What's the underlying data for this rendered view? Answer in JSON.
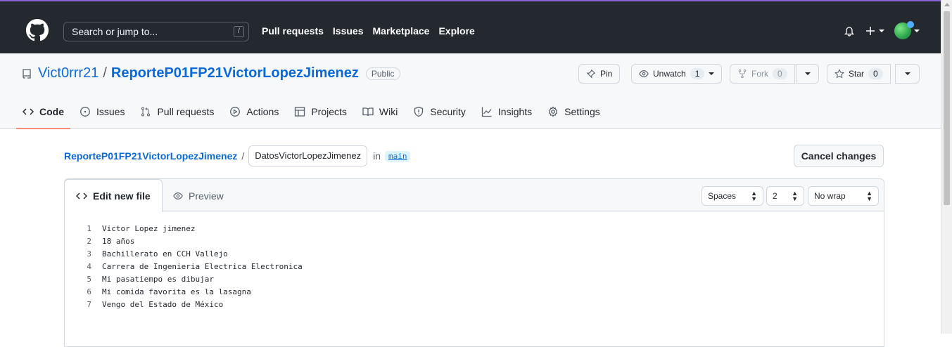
{
  "header": {
    "search_placeholder": "Search or jump to...",
    "slash_key": "/",
    "nav": [
      "Pull requests",
      "Issues",
      "Marketplace",
      "Explore"
    ]
  },
  "repo": {
    "owner": "Vict0rrr21",
    "separator": "/",
    "name": "ReporteP01FP21VictorLopezJimenez",
    "visibility": "Public",
    "pin_label": "Pin",
    "unwatch_label": "Unwatch",
    "unwatch_count": "1",
    "fork_label": "Fork",
    "fork_count": "0",
    "star_label": "Star",
    "star_count": "0"
  },
  "tabs": [
    {
      "label": "Code",
      "icon": "code-icon",
      "active": true
    },
    {
      "label": "Issues",
      "icon": "issue-icon"
    },
    {
      "label": "Pull requests",
      "icon": "pull-request-icon"
    },
    {
      "label": "Actions",
      "icon": "play-icon"
    },
    {
      "label": "Projects",
      "icon": "table-icon"
    },
    {
      "label": "Wiki",
      "icon": "book-icon"
    },
    {
      "label": "Security",
      "icon": "shield-icon"
    },
    {
      "label": "Insights",
      "icon": "graph-icon"
    },
    {
      "label": "Settings",
      "icon": "gear-icon"
    }
  ],
  "editor_path": {
    "root": "ReporteP01FP21VictorLopezJimenez",
    "slash": "/",
    "filename": "DatosVictorLopezJimenez",
    "in_label": "in",
    "branch": "main",
    "cancel_label": "Cancel changes"
  },
  "editor": {
    "edit_tab": "Edit new file",
    "preview_tab": "Preview",
    "indent_mode": "Spaces",
    "indent_size": "2",
    "wrap_mode": "No wrap",
    "lines": [
      "Victor Lopez jimenez",
      "18 años",
      "Bachillerato en CCH Vallejo",
      "Carrera de Ingenieria Electrica Electronica",
      "Mi pasatiempo es dibujar",
      "Mi comida favorita es la lasagna",
      "Vengo del Estado de México"
    ]
  },
  "colors": {
    "header_bg": "#24292f",
    "link": "#0969da",
    "active_tab_underline": "#fd8c73"
  }
}
